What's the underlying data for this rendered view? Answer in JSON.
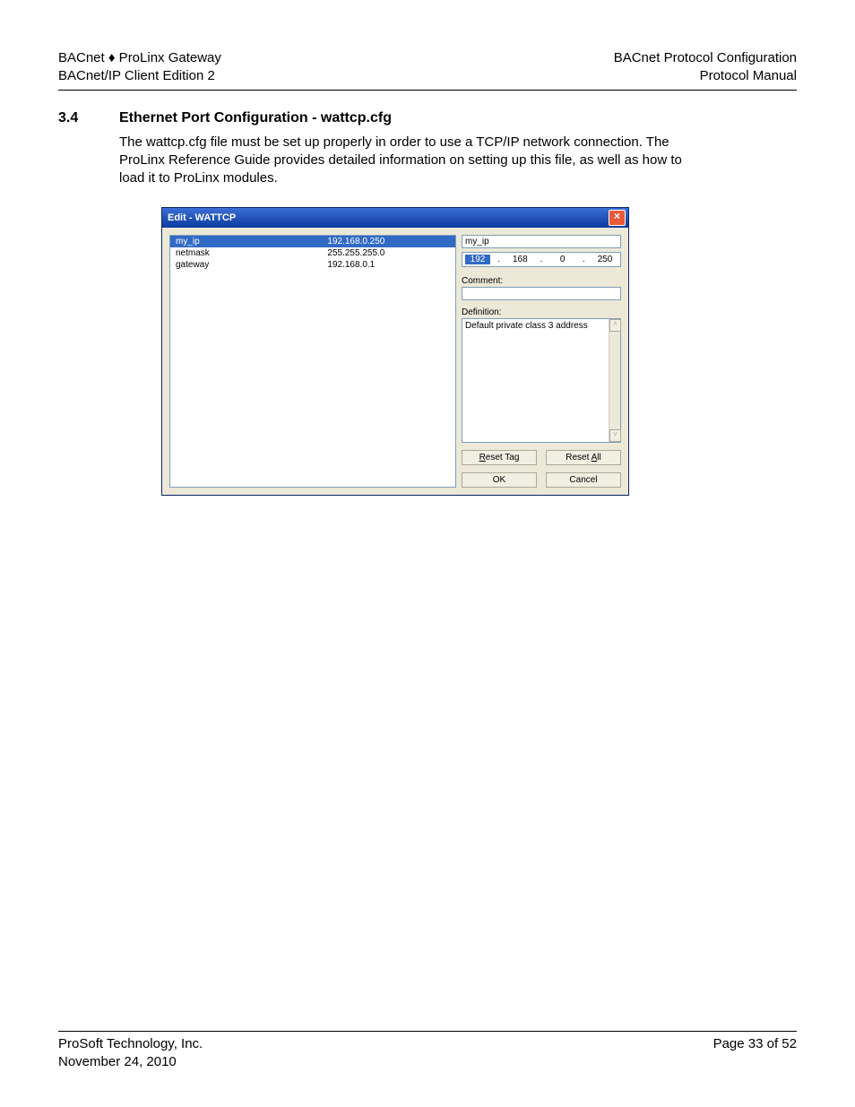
{
  "header": {
    "left1": "BACnet ♦ ProLinx Gateway",
    "left2": "BACnet/IP Client Edition 2",
    "right1": "BACnet Protocol Configuration",
    "right2": "Protocol Manual"
  },
  "section": {
    "num": "3.4",
    "title": "Ethernet Port Configuration - wattcp.cfg",
    "body": "The wattcp.cfg file must be set up properly in order to use a TCP/IP network connection. The ProLinx Reference Guide provides detailed information on setting up this file, as well as how to load it to ProLinx modules."
  },
  "dialog": {
    "title": "Edit - WATTCP",
    "close_glyph": "×",
    "params": [
      {
        "name": "my_ip",
        "value": "192.168.0.250",
        "sel": true
      },
      {
        "name": "netmask",
        "value": "255.255.255.0",
        "sel": false
      },
      {
        "name": "gateway",
        "value": "192.168.0.1",
        "sel": false
      }
    ],
    "field_name": "my_ip",
    "ip": {
      "a": "192",
      "b": "168",
      "c": "0",
      "d": "250"
    },
    "comment_label": "Comment:",
    "definition_label": "Definition:",
    "definition_text": "Default private class 3 address",
    "buttons": {
      "reset_tag": "Reset Tag",
      "reset_all": "Reset All",
      "ok": "OK",
      "cancel": "Cancel"
    },
    "scroll_up": "˄",
    "scroll_dn": "˅"
  },
  "footer": {
    "left1": "ProSoft Technology, Inc.",
    "left2": "November 24, 2010",
    "right": "Page 33 of 52"
  }
}
